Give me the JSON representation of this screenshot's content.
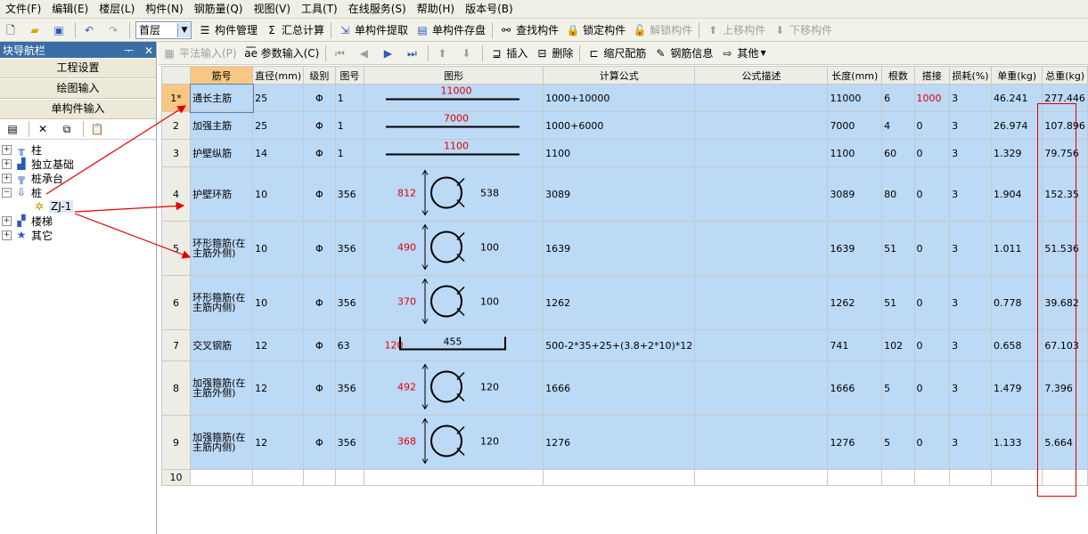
{
  "menu": [
    "文件(F)",
    "编辑(E)",
    "楼层(L)",
    "构件(N)",
    "钢筋量(Q)",
    "视图(V)",
    "工具(T)",
    "在线服务(S)",
    "帮助(H)",
    "版本号(B)"
  ],
  "toolbar1": {
    "floor": "首层",
    "component_manage": "构件管理",
    "summary_calc": "汇总计算",
    "single_extract": "单构件提取",
    "single_save": "单构件存盘",
    "find_component": "查找构件",
    "lock_component": "锁定构件",
    "unlock_component": "解锁构件",
    "move_up": "上移构件",
    "move_down": "下移构件",
    "sigma": "Σ"
  },
  "nav": {
    "title": "块导航栏",
    "pin": "ᅮ",
    "close": "✕",
    "buttons": [
      "工程设置",
      "绘图输入",
      "单构件输入"
    ],
    "tree": [
      {
        "label": "柱",
        "expanded": false
      },
      {
        "label": "独立基础",
        "expanded": false
      },
      {
        "label": "桩承台",
        "expanded": false
      },
      {
        "label": "桩",
        "expanded": true
      },
      {
        "label": "ZJ-1",
        "child": true
      },
      {
        "label": "楼梯",
        "expanded": false
      },
      {
        "label": "其它",
        "expanded": false
      }
    ]
  },
  "toolbar2": {
    "flat_input": "平法输入(P)",
    "param_input": "参数输入(C)",
    "insert": "插入",
    "delete": "删除",
    "scale_rebar": "缩尺配筋",
    "rebar_info": "钢筋信息",
    "other": "其他"
  },
  "columns": [
    "筋号",
    "直径(mm)",
    "级别",
    "图号",
    "图形",
    "计算公式",
    "公式描述",
    "长度(mm)",
    "根数",
    "搭接",
    "损耗(%)",
    "单重(kg)",
    "总重(kg)"
  ],
  "rows": [
    {
      "no": "1*",
      "name": "通长主筋",
      "dia": "25",
      "grade": "Φ",
      "fig": "1",
      "shape": "line",
      "dims": [
        "11000"
      ],
      "formula": "1000+10000",
      "desc": "",
      "length": "11000",
      "count": "6",
      "lap": "1000",
      "loss": "3",
      "unit": "46.241",
      "total": "277.446"
    },
    {
      "no": "2",
      "name": "加强主筋",
      "dia": "25",
      "grade": "Φ",
      "fig": "1",
      "shape": "line",
      "dims": [
        "7000"
      ],
      "formula": "1000+6000",
      "desc": "",
      "length": "7000",
      "count": "4",
      "lap": "0",
      "loss": "3",
      "unit": "26.974",
      "total": "107.896"
    },
    {
      "no": "3",
      "name": "护壁纵筋",
      "dia": "14",
      "grade": "Φ",
      "fig": "1",
      "shape": "line",
      "dims": [
        "1100"
      ],
      "formula": "1100",
      "desc": "",
      "length": "1100",
      "count": "60",
      "lap": "0",
      "loss": "3",
      "unit": "1.329",
      "total": "79.756"
    },
    {
      "no": "4",
      "name": "护壁环筋",
      "dia": "10",
      "grade": "Φ",
      "fig": "356",
      "shape": "ring",
      "dims": [
        "812",
        "538"
      ],
      "formula": "3089",
      "desc": "",
      "length": "3089",
      "count": "80",
      "lap": "0",
      "loss": "3",
      "unit": "1.904",
      "total": "152.35"
    },
    {
      "no": "5",
      "name": "环形箍筋(在主筋外侧)",
      "dia": "10",
      "grade": "Φ",
      "fig": "356",
      "shape": "ring",
      "dims": [
        "490",
        "100"
      ],
      "formula": "1639",
      "desc": "",
      "length": "1639",
      "count": "51",
      "lap": "0",
      "loss": "3",
      "unit": "1.011",
      "total": "51.536"
    },
    {
      "no": "6",
      "name": "环形箍筋(在主筋内侧)",
      "dia": "10",
      "grade": "Φ",
      "fig": "356",
      "shape": "ring",
      "dims": [
        "370",
        "100"
      ],
      "formula": "1262",
      "desc": "",
      "length": "1262",
      "count": "51",
      "lap": "0",
      "loss": "3",
      "unit": "0.778",
      "total": "39.682"
    },
    {
      "no": "7",
      "name": "交叉钢筋",
      "dia": "12",
      "grade": "Φ",
      "fig": "63",
      "shape": "bracket",
      "dims": [
        "120",
        "455"
      ],
      "formula": "500-2*35+25+(3.8+2*10)*12",
      "desc": "",
      "length": "741",
      "count": "102",
      "lap": "0",
      "loss": "3",
      "unit": "0.658",
      "total": "67.103"
    },
    {
      "no": "8",
      "name": "加强箍筋(在主筋外侧)",
      "dia": "12",
      "grade": "Φ",
      "fig": "356",
      "shape": "ring",
      "dims": [
        "492",
        "120"
      ],
      "formula": "1666",
      "desc": "",
      "length": "1666",
      "count": "5",
      "lap": "0",
      "loss": "3",
      "unit": "1.479",
      "total": "7.396"
    },
    {
      "no": "9",
      "name": "加强箍筋(在主筋内侧)",
      "dia": "12",
      "grade": "Φ",
      "fig": "356",
      "shape": "ring",
      "dims": [
        "368",
        "120"
      ],
      "formula": "1276",
      "desc": "",
      "length": "1276",
      "count": "5",
      "lap": "0",
      "loss": "3",
      "unit": "1.133",
      "total": "5.664"
    },
    {
      "no": "10",
      "empty": true
    }
  ]
}
